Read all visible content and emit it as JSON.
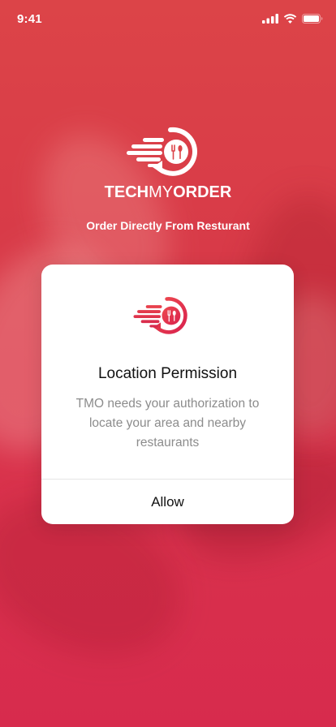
{
  "status_bar": {
    "time": "9:41",
    "icons": [
      "cellular-signal-icon",
      "wifi-icon",
      "battery-icon"
    ]
  },
  "brand": {
    "logo_icon": "techmyorder-logo-icon",
    "name_part1": "TECH",
    "name_part2": "MY",
    "name_part3": "ORDER",
    "tagline": "Order Directly From Resturant"
  },
  "dialog": {
    "logo_icon": "techmyorder-logo-icon",
    "title": "Location Permission",
    "message": "TMO needs your authorization to locate your area and nearby restaurants",
    "allow_label": "Allow"
  },
  "colors": {
    "background_top": "#dc4448",
    "background_bottom": "#d72b4d",
    "accent": "#e0344a",
    "card_background": "#ffffff"
  }
}
